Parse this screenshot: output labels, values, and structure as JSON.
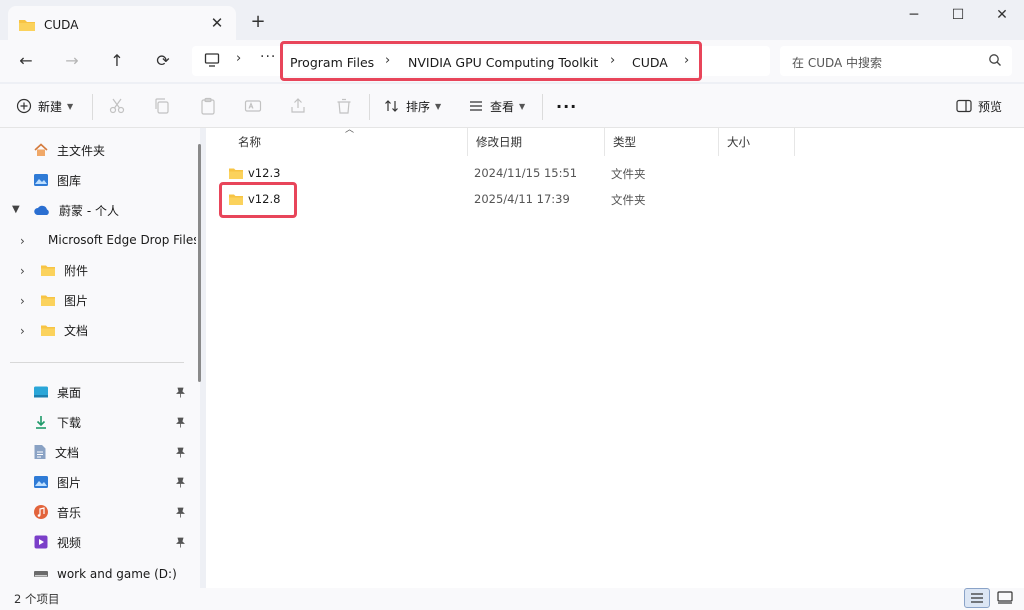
{
  "window": {
    "tab_title": "CUDA",
    "new_tab": "+",
    "tab_close": "✕",
    "minimize": "─",
    "maximize": "☐",
    "close": "✕"
  },
  "nav": {
    "back": "←",
    "forward": "→",
    "up": "↑",
    "refresh": "⟳",
    "overflow": "···",
    "breadcrumb": [
      "Program Files",
      "NVIDIA GPU Computing Toolkit",
      "CUDA"
    ],
    "search_placeholder": "在 CUDA 中搜索"
  },
  "toolbar": {
    "new_label": "新建",
    "sort_label": "排序",
    "view_label": "查看",
    "more": "···",
    "preview_label": "预览"
  },
  "sidebar": {
    "top": [
      "主文件夹",
      "图库",
      "蔚蒙 - 个人"
    ],
    "cloud_children": [
      "Microsoft Edge Drop Files",
      "附件",
      "图片",
      "文档"
    ],
    "quick": [
      "桌面",
      "下载",
      "文档",
      "图片",
      "音乐",
      "视频",
      "work and game  (D:)"
    ]
  },
  "columns": [
    "名称",
    "修改日期",
    "类型",
    "大小"
  ],
  "files": [
    {
      "name": "v12.3",
      "date": "2024/11/15 15:51",
      "type": "文件夹"
    },
    {
      "name": "v12.8",
      "date": "2025/4/11 17:39",
      "type": "文件夹"
    }
  ],
  "status": {
    "count": "2 个项目"
  },
  "colors": {
    "highlight": "#e8455a",
    "folder": "#f7c444",
    "accent": "#0067c0"
  }
}
